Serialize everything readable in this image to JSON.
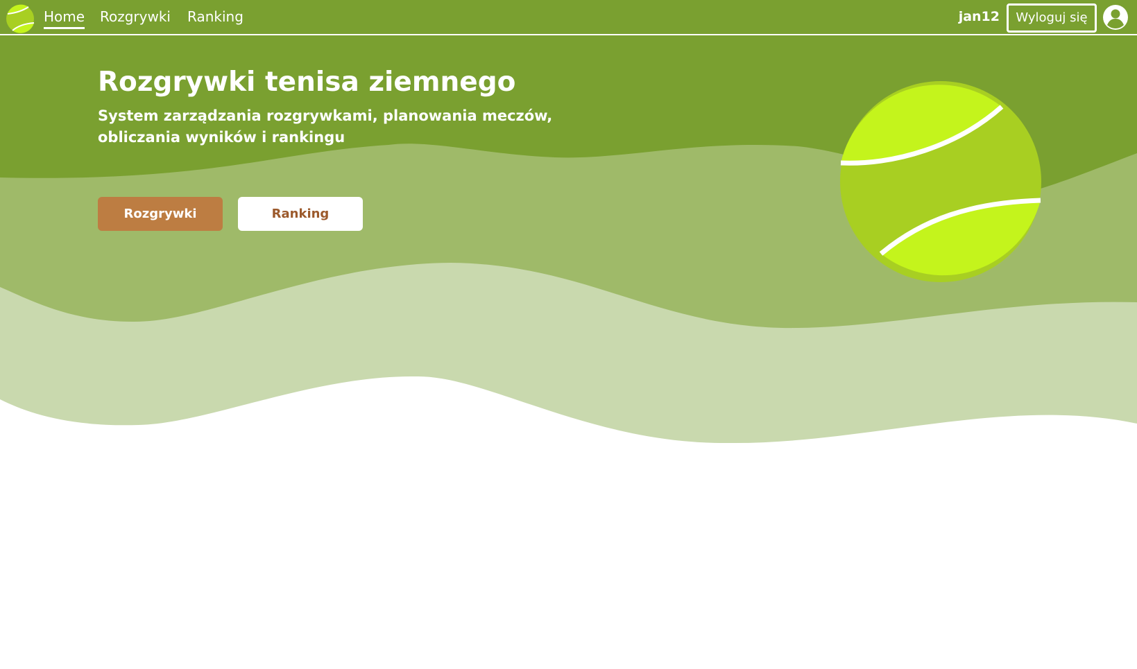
{
  "nav": {
    "logo_icon": "tennis-ball-icon",
    "links": [
      {
        "label": "Home",
        "active": true
      },
      {
        "label": "Rozgrywki",
        "active": false
      },
      {
        "label": "Ranking",
        "active": false
      }
    ],
    "username": "jan12",
    "logout_label": "Wyloguj się",
    "avatar_icon": "user-circle-icon"
  },
  "hero": {
    "title": "Rozgrywki tenisa ziemnego",
    "subtitle": "System zarządzania rozgrywkami, planowania meczów, obliczania wyników i rankingu",
    "primary_button": "Rozgrywki",
    "secondary_button": "Ranking",
    "illustration_icon": "tennis-ball-icon"
  },
  "colors": {
    "primary_green": "#7aa030",
    "mid_green": "#9fba69",
    "light_green": "#c9d9ae",
    "ball_yellow": "#c4f41c",
    "ball_shade": "#a8cf22",
    "primary_button": "#bd7d42",
    "secondary_button_text": "#9c5a2c"
  }
}
